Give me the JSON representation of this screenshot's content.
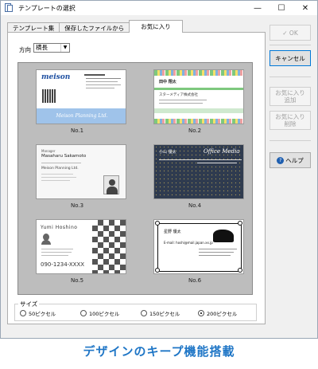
{
  "window": {
    "title": "テンプレートの選択",
    "controls": {
      "minimize": "—",
      "maximize": "☐",
      "close": "✕"
    }
  },
  "tabs": [
    {
      "label": "テンプレート集",
      "active": false
    },
    {
      "label": "保存したファイルから",
      "active": false
    },
    {
      "label": "お気に入り",
      "active": true
    }
  ],
  "direction": {
    "label": "方向",
    "value": "横長"
  },
  "cards": [
    {
      "label": "No.1",
      "brand": "meison",
      "company": "Meison Planning Ltd."
    },
    {
      "label": "No.2",
      "name_jp": "田中 翔太",
      "company": "スターメディア株式会社"
    },
    {
      "label": "No.3",
      "title": "Manager",
      "name": "Masaharu Sakamoto",
      "company": "Meison Planning Ltd."
    },
    {
      "label": "No.4",
      "name_jp": "小山 優太",
      "company": "Office Media"
    },
    {
      "label": "No.5",
      "name": "Yumi Hoshino",
      "phone": "090-1234-XXXX"
    },
    {
      "label": "No.6",
      "name_jp": "星野 優太",
      "email": "E-mail: hoshi@mail.japan.xx.jp"
    }
  ],
  "size": {
    "title": "サイズ",
    "options": [
      {
        "label": "50ピクセル",
        "checked": false
      },
      {
        "label": "100ピクセル",
        "checked": false
      },
      {
        "label": "150ピクセル",
        "checked": false
      },
      {
        "label": "200ピクセル",
        "checked": true
      }
    ]
  },
  "buttons": {
    "ok": "✓ OK",
    "cancel": "キャンセル",
    "add_fav_1": "お気に入り",
    "add_fav_2": "追加",
    "del_fav_1": "お気に入り",
    "del_fav_2": "削除",
    "help": "ヘルプ"
  },
  "caption": "デザインのキープ機能搭載",
  "colors": {
    "accent": "#1f76c6",
    "card1_band": "#9fc3ea",
    "card4_bg": "#2f3b4f",
    "card2_stripe": "#7ec87e"
  }
}
